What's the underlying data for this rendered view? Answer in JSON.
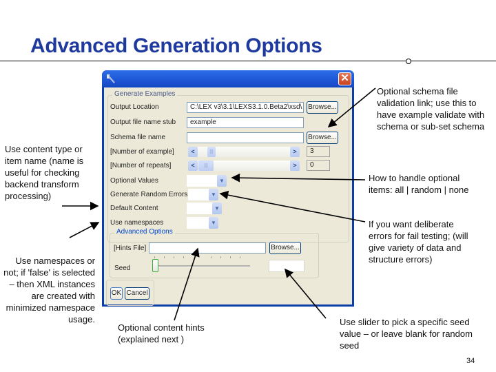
{
  "slide": {
    "title": "Advanced Generation Options",
    "page_number": "34"
  },
  "dialog": {
    "close_glyph": "✕",
    "generate_examples": {
      "legend": "Generate Examples",
      "output_location": {
        "label": "Output Location",
        "value": "C:\\LEX v3\\3.1\\LEXS3.1.0.Beta2\\xsd\\",
        "button": "Browse..."
      },
      "output_stub": {
        "label": "Output file name stub",
        "value": "example"
      },
      "schema_file": {
        "label": "Schema file name",
        "value": "",
        "button": "Browse..."
      },
      "number_of_example": {
        "label": "[Number of example]",
        "value": "3",
        "scroll_left": "<",
        "scroll_right": ">"
      },
      "number_of_repeats": {
        "label": "[Number of repeats]",
        "value": "0",
        "scroll_left": "<",
        "scroll_right": ">"
      },
      "optional_values": {
        "label": "Optional Values",
        "value": ""
      },
      "random_errors": {
        "label": "Generate Random Errors",
        "value": ""
      },
      "default_content": {
        "label": "Default Content",
        "value": ""
      },
      "use_namespaces": {
        "label": "Use namespaces",
        "value": ""
      }
    },
    "advanced_options": {
      "legend": "Advanced Options",
      "hints_file": {
        "label": "[Hints File]",
        "value": "",
        "button": "Browse..."
      },
      "seed": {
        "label": "Seed",
        "value": "",
        "slider_position": 0
      }
    },
    "buttons": {
      "ok": "OK",
      "cancel": "Cancel"
    }
  },
  "annotations": {
    "schema_note": "Optional schema file validation link; use this to have example validate with schema or sub-set schema",
    "content_type_note": "Use content type or item name (name is useful for checking backend transform processing)",
    "optional_note": "How to handle optional items: all | random | none",
    "errors_note": "If you want deliberate errors for fail testing; (will give variety of data and structure errors)",
    "namespaces_note": "Use namespaces or not; if 'false' is selected – then XML instances are created with minimized namespace usage.",
    "hints_note": "Optional content hints (explained next )",
    "seed_note": "Use slider to pick a specific seed value – or leave blank for random seed"
  }
}
